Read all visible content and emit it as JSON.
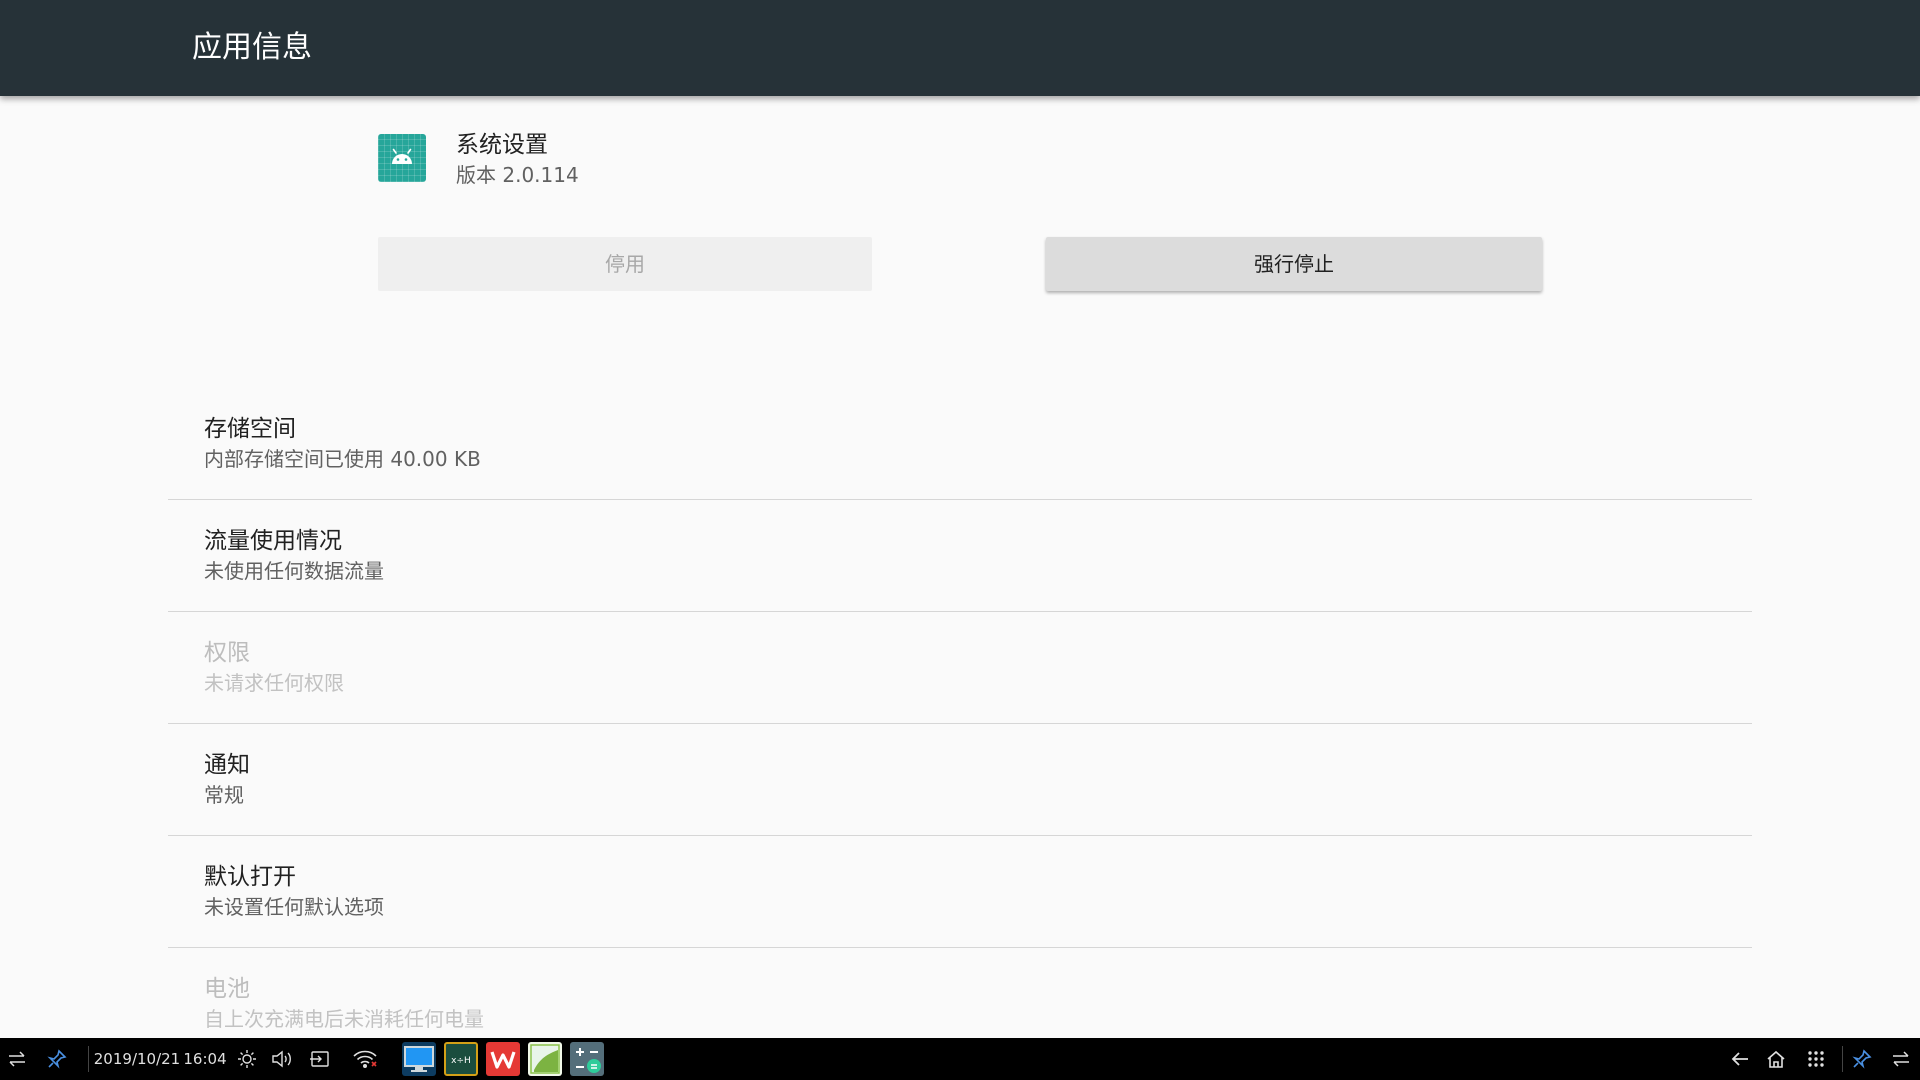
{
  "appbar": {
    "title": "应用信息"
  },
  "app": {
    "name": "系统设置",
    "version": "版本 2.0.114",
    "icon": "android-icon",
    "icon_color": "#26a69a"
  },
  "buttons": {
    "disable_label": "停用",
    "force_stop_label": "强行停止"
  },
  "list": {
    "items": [
      {
        "title": "存储空间",
        "summary": "内部存储空间已使用 40.00 KB",
        "enabled": true
      },
      {
        "title": "流量使用情况",
        "summary": "未使用任何数据流量",
        "enabled": true
      },
      {
        "title": "权限",
        "summary": "未请求任何权限",
        "enabled": false
      },
      {
        "title": "通知",
        "summary": "常规",
        "enabled": true
      },
      {
        "title": "默认打开",
        "summary": "未设置任何默认选项",
        "enabled": true
      },
      {
        "title": "电池",
        "summary": "自上次充满电后未消耗任何电量",
        "enabled": false
      }
    ]
  },
  "taskbar": {
    "date": "2019/10/21",
    "time": "16:04",
    "apps": [
      "desktop-app-icon",
      "blackboard-app-icon",
      "wps-office-app-icon",
      "gallery-app-icon",
      "calculator-app-icon"
    ],
    "colors": {
      "background": "#000000",
      "wps": "#e53935",
      "calculator": "#546e7a"
    }
  }
}
